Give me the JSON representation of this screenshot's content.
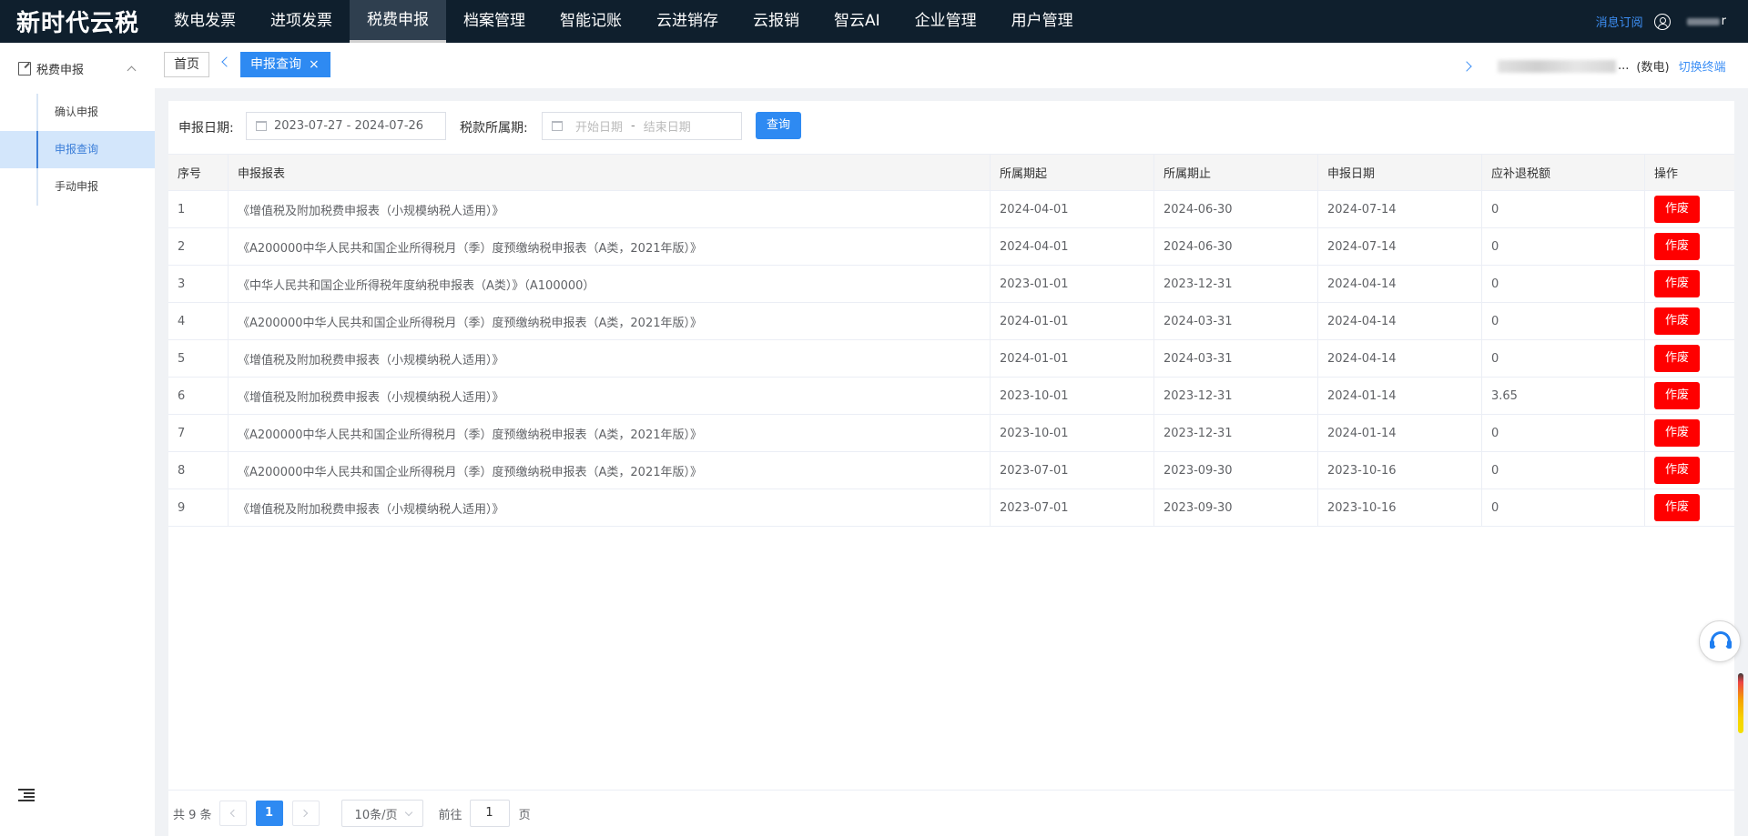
{
  "app": {
    "logo": "新时代云税"
  },
  "nav": {
    "items": [
      {
        "label": "数电发票"
      },
      {
        "label": "进项发票"
      },
      {
        "label": "税费申报"
      },
      {
        "label": "档案管理"
      },
      {
        "label": "智能记账"
      },
      {
        "label": "云进销存"
      },
      {
        "label": "云报销"
      },
      {
        "label": "智云AI"
      },
      {
        "label": "企业管理"
      },
      {
        "label": "用户管理"
      }
    ],
    "active_index": 2,
    "message_link": "消息订阅",
    "user_suffix": "r"
  },
  "sidebar": {
    "header": "税费申报",
    "items": [
      {
        "label": "确认申报"
      },
      {
        "label": "申报查询"
      },
      {
        "label": "手动申报"
      }
    ],
    "active_index": 1
  },
  "tabs": {
    "home": "首页",
    "active": "申报查询",
    "close": "×",
    "company_suffix": "...",
    "company_tag": "(数电)",
    "switch_label": "切换终端"
  },
  "filter": {
    "declare_date_label": "申报日期:",
    "declare_date_value": "2023-07-27 - 2024-07-26",
    "tax_period_label": "税款所属期:",
    "start_placeholder": "开始日期",
    "range_sep": "-",
    "end_placeholder": "结束日期",
    "query_button": "查询"
  },
  "table": {
    "headers": [
      "序号",
      "申报报表",
      "所属期起",
      "所属期止",
      "申报日期",
      "应补退税额",
      "操作"
    ],
    "action_label": "作废",
    "rows": [
      [
        "1",
        "《增值税及附加税费申报表（小规模纳税人适用）》",
        "2024-04-01",
        "2024-06-30",
        "2024-07-14",
        "0"
      ],
      [
        "2",
        "《A200000中华人民共和国企业所得税月（季）度预缴纳税申报表（A类，2021年版）》",
        "2024-04-01",
        "2024-06-30",
        "2024-07-14",
        "0"
      ],
      [
        "3",
        "《中华人民共和国企业所得税年度纳税申报表（A类）》（A100000）",
        "2023-01-01",
        "2023-12-31",
        "2024-04-14",
        "0"
      ],
      [
        "4",
        "《A200000中华人民共和国企业所得税月（季）度预缴纳税申报表（A类，2021年版）》",
        "2024-01-01",
        "2024-03-31",
        "2024-04-14",
        "0"
      ],
      [
        "5",
        "《增值税及附加税费申报表（小规模纳税人适用）》",
        "2024-01-01",
        "2024-03-31",
        "2024-04-14",
        "0"
      ],
      [
        "6",
        "《增值税及附加税费申报表（小规模纳税人适用）》",
        "2023-10-01",
        "2023-12-31",
        "2024-01-14",
        "3.65"
      ],
      [
        "7",
        "《A200000中华人民共和国企业所得税月（季）度预缴纳税申报表（A类，2021年版）》",
        "2023-10-01",
        "2023-12-31",
        "2024-01-14",
        "0"
      ],
      [
        "8",
        "《A200000中华人民共和国企业所得税月（季）度预缴纳税申报表（A类，2021年版）》",
        "2023-07-01",
        "2023-09-30",
        "2023-10-16",
        "0"
      ],
      [
        "9",
        "《增值税及附加税费申报表（小规模纳税人适用）》",
        "2023-07-01",
        "2023-09-30",
        "2023-10-16",
        "0"
      ]
    ]
  },
  "pagination": {
    "total": "共 9 条",
    "current_page": "1",
    "page_size": "10条/页",
    "goto_prefix": "前往",
    "goto_value": "1",
    "goto_suffix": "页"
  },
  "colors": {
    "topbar": "#0f1f2d",
    "accent": "#2e8af2",
    "danger": "#ff0000"
  }
}
